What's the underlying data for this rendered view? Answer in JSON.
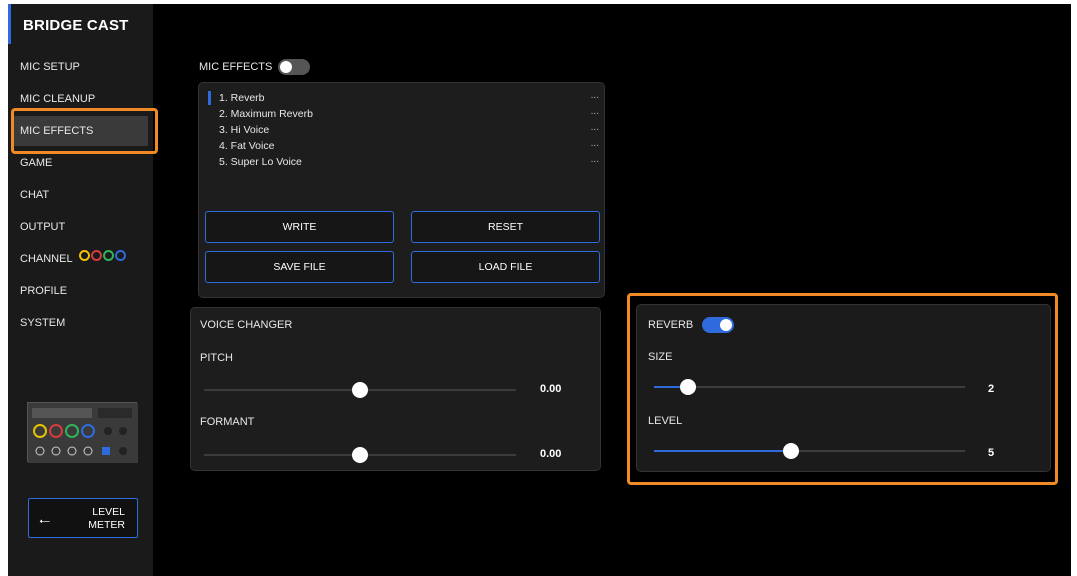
{
  "app": {
    "title": "BRIDGE CAST"
  },
  "sidebar": {
    "items": [
      {
        "label": "MIC SETUP"
      },
      {
        "label": "MIC CLEANUP"
      },
      {
        "label": "MIC EFFECTS"
      },
      {
        "label": "GAME"
      },
      {
        "label": "CHAT"
      },
      {
        "label": "OUTPUT"
      },
      {
        "label": "CHANNEL"
      },
      {
        "label": "PROFILE"
      },
      {
        "label": "SYSTEM"
      }
    ],
    "active_item": "MIC EFFECTS",
    "channel_colors": [
      "#f2c200",
      "#d43b3b",
      "#2fb55a",
      "#2f6bdc"
    ],
    "level_meter": {
      "line1": "LEVEL",
      "line2": "METER",
      "icon": "arrow-left-icon"
    }
  },
  "mic_effects": {
    "label": "MIC EFFECTS",
    "enabled": false,
    "presets": [
      {
        "name": "1. Reverb",
        "menu": "..."
      },
      {
        "name": "2. Maximum Reverb",
        "menu": "..."
      },
      {
        "name": "3. Hi Voice",
        "menu": "..."
      },
      {
        "name": "4. Fat Voice",
        "menu": "..."
      },
      {
        "name": "5. Super Lo Voice",
        "menu": "..."
      }
    ],
    "selected_preset": "1. Reverb",
    "buttons": {
      "write": "WRITE",
      "reset": "RESET",
      "save": "SAVE FILE",
      "load": "LOAD FILE"
    }
  },
  "voice_changer": {
    "title": "VOICE CHANGER",
    "pitch": {
      "label": "PITCH",
      "value": "0.00",
      "level": 0.5
    },
    "formant": {
      "label": "FORMANT",
      "value": "0.00",
      "level": 0.5
    }
  },
  "reverb": {
    "label": "REVERB",
    "enabled": true,
    "size": {
      "label": "SIZE",
      "value": "2",
      "level": 0.11
    },
    "level": {
      "label": "LEVEL",
      "value": "5",
      "level": 0.44
    }
  },
  "colors": {
    "accent": "#2f6bdc",
    "highlight": "#f08a24"
  }
}
